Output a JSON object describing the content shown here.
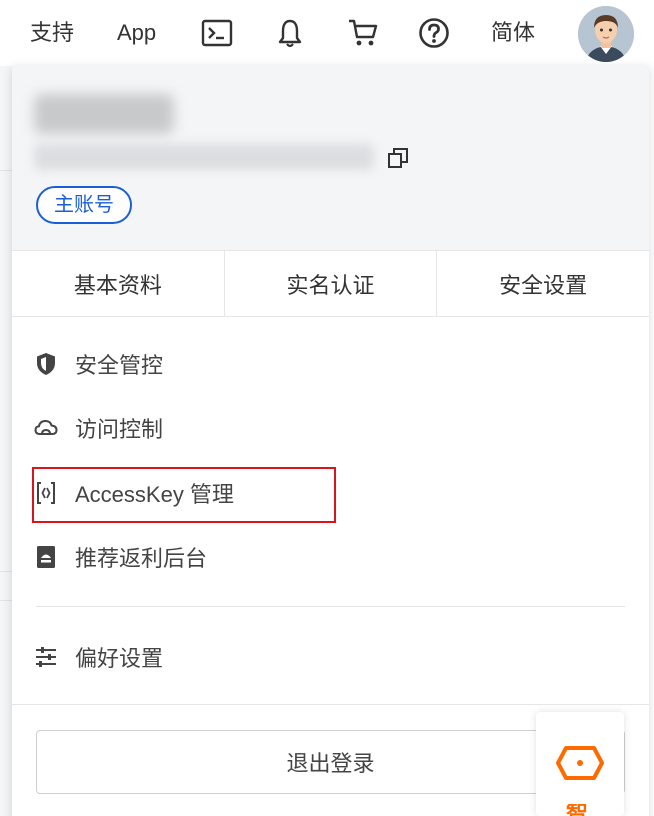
{
  "topbar": {
    "support_label": "支持",
    "app_label": "App",
    "language_label": "简体",
    "icons": [
      "terminal-icon",
      "bell-icon",
      "cart-icon",
      "help-icon"
    ]
  },
  "account": {
    "name": "",
    "id": "",
    "badge": "主账号"
  },
  "tabs": [
    {
      "label": "基本资料"
    },
    {
      "label": "实名认证"
    },
    {
      "label": "安全设置"
    }
  ],
  "menu": [
    {
      "label": "安全管控",
      "icon": "shield-icon"
    },
    {
      "label": "访问控制",
      "icon": "cloud-icon"
    },
    {
      "label": "AccessKey 管理",
      "icon": "key-icon"
    },
    {
      "label": "推荐返利后台",
      "icon": "book-icon"
    },
    {
      "label": "偏好设置",
      "icon": "sliders-icon"
    }
  ],
  "logout_label": "退出登录",
  "float_widget": {
    "label": "智",
    "icon": "box-icon"
  },
  "colors": {
    "accent": "#1a5fd6",
    "highlight": "#d9141c",
    "brand_orange": "#ff6a00"
  }
}
